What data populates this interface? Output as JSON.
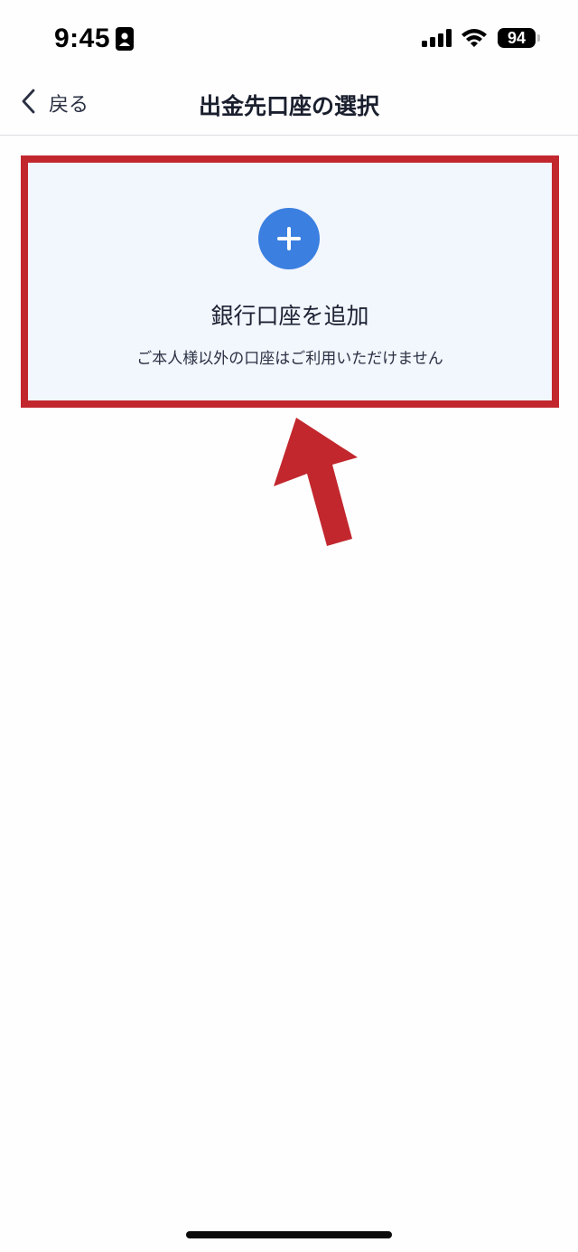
{
  "status_bar": {
    "time": "9:45",
    "battery": "94",
    "icons": [
      "contact-card-icon",
      "signal-icon",
      "wifi-icon",
      "battery-icon"
    ]
  },
  "nav": {
    "back_label": "戻る",
    "title": "出金先口座の選択",
    "back_icon": "chevron-left-icon"
  },
  "add_bank": {
    "icon": "plus-circle-icon",
    "title": "銀行口座を追加",
    "note": "ご本人様以外の口座はご利用いただけません"
  },
  "colors": {
    "accent": "#3b7fe0",
    "card_background": "#f2f6fd",
    "annotation_red": "#c2272e"
  }
}
